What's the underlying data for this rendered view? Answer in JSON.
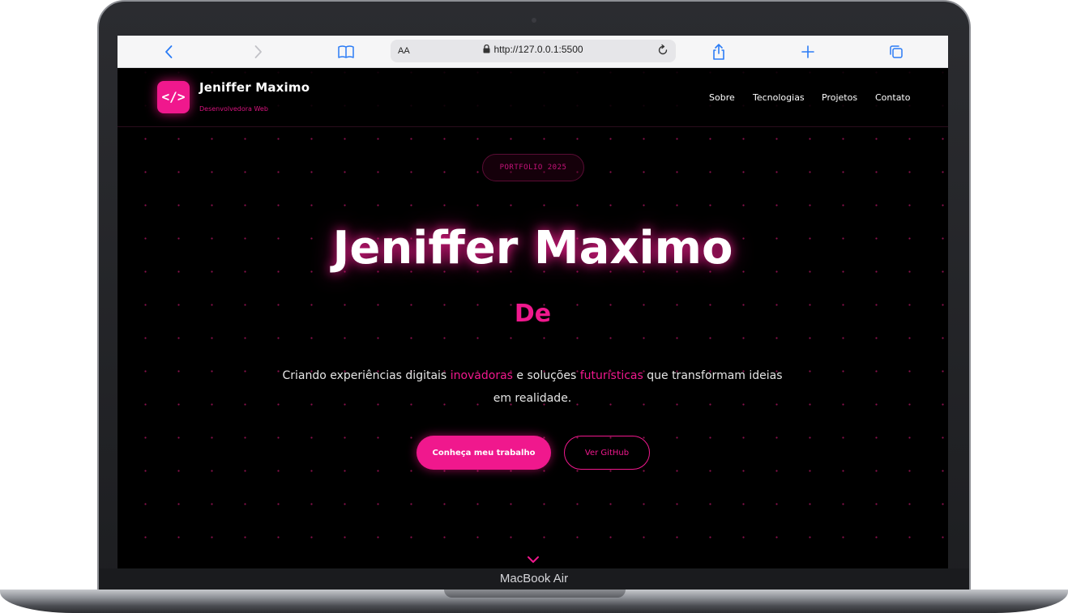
{
  "device": {
    "label": "MacBook Air"
  },
  "browser": {
    "text_size_label": "AA",
    "url": "http://127.0.0.1:5500"
  },
  "site": {
    "logo_glyph": "</>",
    "brand_name": "Jeniffer Maximo",
    "brand_subtitle": "Desenvolvedora Web",
    "nav": [
      "Sobre",
      "Tecnologias",
      "Projetos",
      "Contato"
    ],
    "badge": "PORTFOLIO 2025",
    "hero_title": "Jeniffer Maximo",
    "typed_text": "De",
    "description": {
      "part1": "Criando experiências digitais ",
      "highlight1": "inovadoras",
      "part2": " e soluções ",
      "highlight2": "futurísticas",
      "part3": " que transformam ideias em realidade."
    },
    "primary_button": "Conheça meu trabalho",
    "secondary_button": "Ver GitHub"
  },
  "colors": {
    "accent": "#f0188d",
    "background": "#000000",
    "toolbar_icon": "#2b7cf6"
  },
  "icons": [
    "chevron-left-icon",
    "chevron-right-icon",
    "book-icon",
    "lock-icon",
    "reload-icon",
    "share-icon",
    "plus-icon",
    "tabs-icon",
    "code-icon",
    "chevron-down-icon"
  ]
}
